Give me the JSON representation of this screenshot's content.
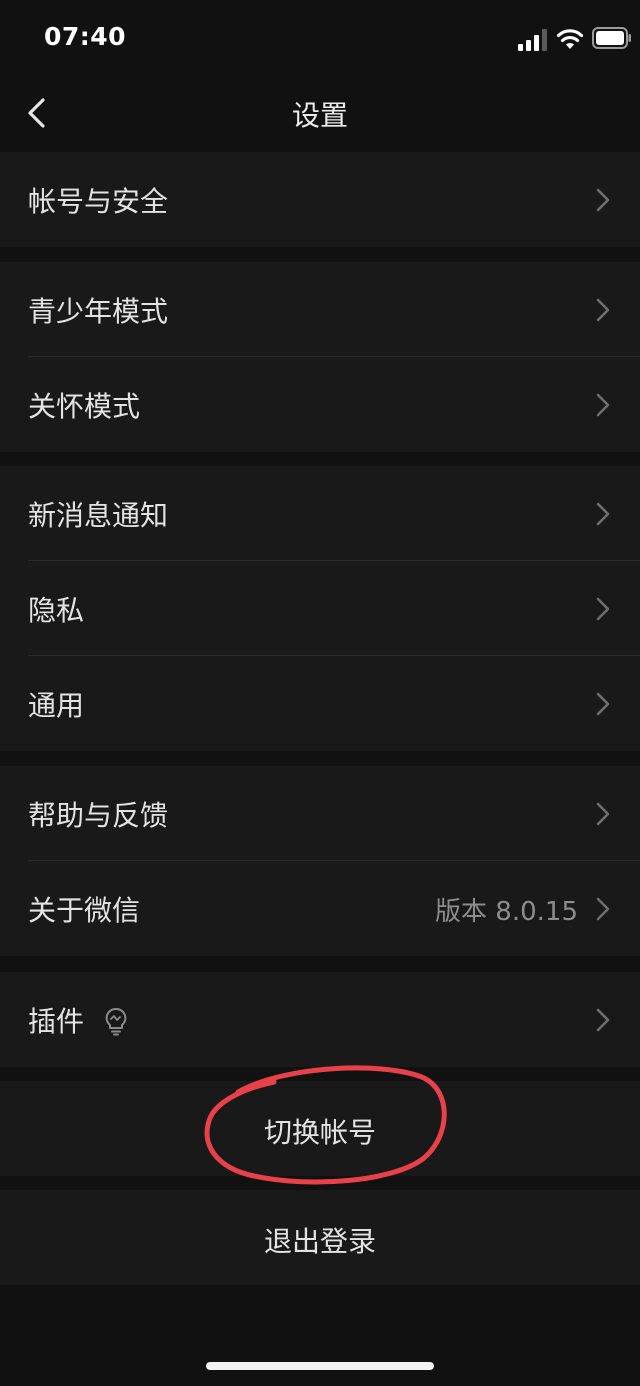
{
  "status_bar": {
    "time": "07:40",
    "icons": [
      "cellular-signal-icon",
      "wifi-icon",
      "battery-icon"
    ]
  },
  "nav": {
    "back_icon": "chevron-left-icon",
    "title": "设置"
  },
  "groups": [
    {
      "items": [
        {
          "label": "帐号与安全"
        }
      ]
    },
    {
      "items": [
        {
          "label": "青少年模式"
        },
        {
          "label": "关怀模式"
        }
      ]
    },
    {
      "items": [
        {
          "label": "新消息通知"
        },
        {
          "label": "隐私"
        },
        {
          "label": "通用"
        }
      ]
    },
    {
      "items": [
        {
          "label": "帮助与反馈"
        },
        {
          "label": "关于微信",
          "value": "版本 8.0.15"
        }
      ]
    },
    {
      "items": [
        {
          "label": "插件",
          "icon": "lightbulb-icon"
        }
      ]
    }
  ],
  "actions": {
    "switch_account": "切换帐号",
    "logout": "退出登录"
  },
  "annotation": {
    "type": "hand-drawn-circle",
    "color": "#e8414a",
    "target": "switch-account-button"
  },
  "colors": {
    "background": "#111111",
    "cell_background": "#191919",
    "text": "#e3e3e3",
    "secondary_text": "#8d8d8d"
  }
}
